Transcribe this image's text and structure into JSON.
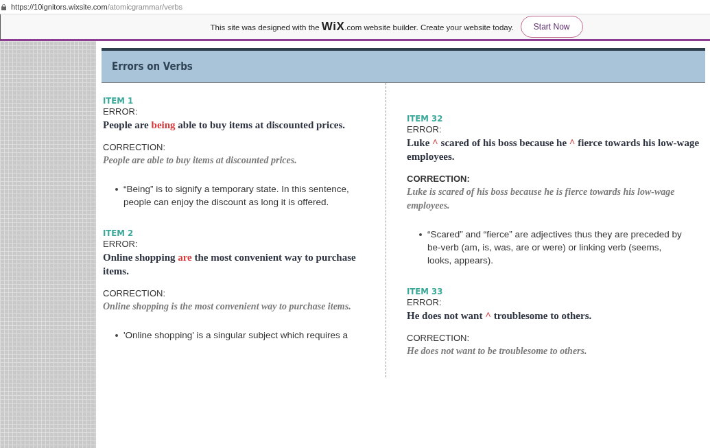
{
  "address_bar": {
    "host": "https://10ignitors.wixsite.com",
    "path": "/atomicgrammar/verbs"
  },
  "banner": {
    "text": "This site was designed with the **WiX**.com website builder. Create your website today.",
    "button": "Start Now"
  },
  "header": {
    "title": "Errors on Verbs"
  },
  "columns": [
    {
      "items": [
        {
          "label": "ITEM 1",
          "error_label": "ERROR:",
          "error": [
            {
              "text": "People are ",
              "highlight": false
            },
            {
              "text": "being",
              "highlight": true
            },
            {
              "text": " able to buy items at discounted prices.",
              "highlight": false
            }
          ],
          "correction_label": "CORRECTION:",
          "correction_label_bold": false,
          "correction": "People are able to buy items at discounted prices.",
          "notes": [
            "“Being” is to signify a temporary state. In this sentence, people can enjoy the discount as long it is offered."
          ]
        },
        {
          "label": "ITEM 2",
          "error_label": "ERROR:",
          "error": [
            {
              "text": "Online shopping ",
              "highlight": false
            },
            {
              "text": "are",
              "highlight": true
            },
            {
              "text": " the most convenient way to purchase items.",
              "highlight": false
            }
          ],
          "correction_label": "CORRECTION:",
          "correction_label_bold": false,
          "correction": "Online shopping is the most convenient way to purchase items.",
          "notes": [
            "'Online shopping' is a singular subject which requires a"
          ]
        }
      ]
    },
    {
      "items": [
        {
          "label": "ITEM 32",
          "error_label": "ERROR:",
          "error": [
            {
              "text": "Luke ",
              "highlight": false
            },
            {
              "text": "^",
              "highlight": true
            },
            {
              "text": " scared of his boss because he ",
              "highlight": false
            },
            {
              "text": "^",
              "highlight": true
            },
            {
              "text": " fierce towards his low-wage employees.",
              "highlight": false
            }
          ],
          "correction_label": "CORRECTION:",
          "correction_label_bold": true,
          "correction": "Luke is scared of his boss because he is fierce towards his low-wage employees.",
          "notes": [
            "“Scared” and “fierce” are adjectives thus they are preceded by be-verb (am, is, was, are or were) or linking verb (seems, looks, appears)."
          ]
        },
        {
          "label": "ITEM 33",
          "error_label": "ERROR:",
          "error": [
            {
              "text": "He does not want ",
              "highlight": false
            },
            {
              "text": "^",
              "highlight": true
            },
            {
              "text": " troublesome to others.",
              "highlight": false
            }
          ],
          "correction_label": "CORRECTION:",
          "correction_label_bold": false,
          "correction": "He does not want to be troublesome to others."
        }
      ]
    }
  ]
}
